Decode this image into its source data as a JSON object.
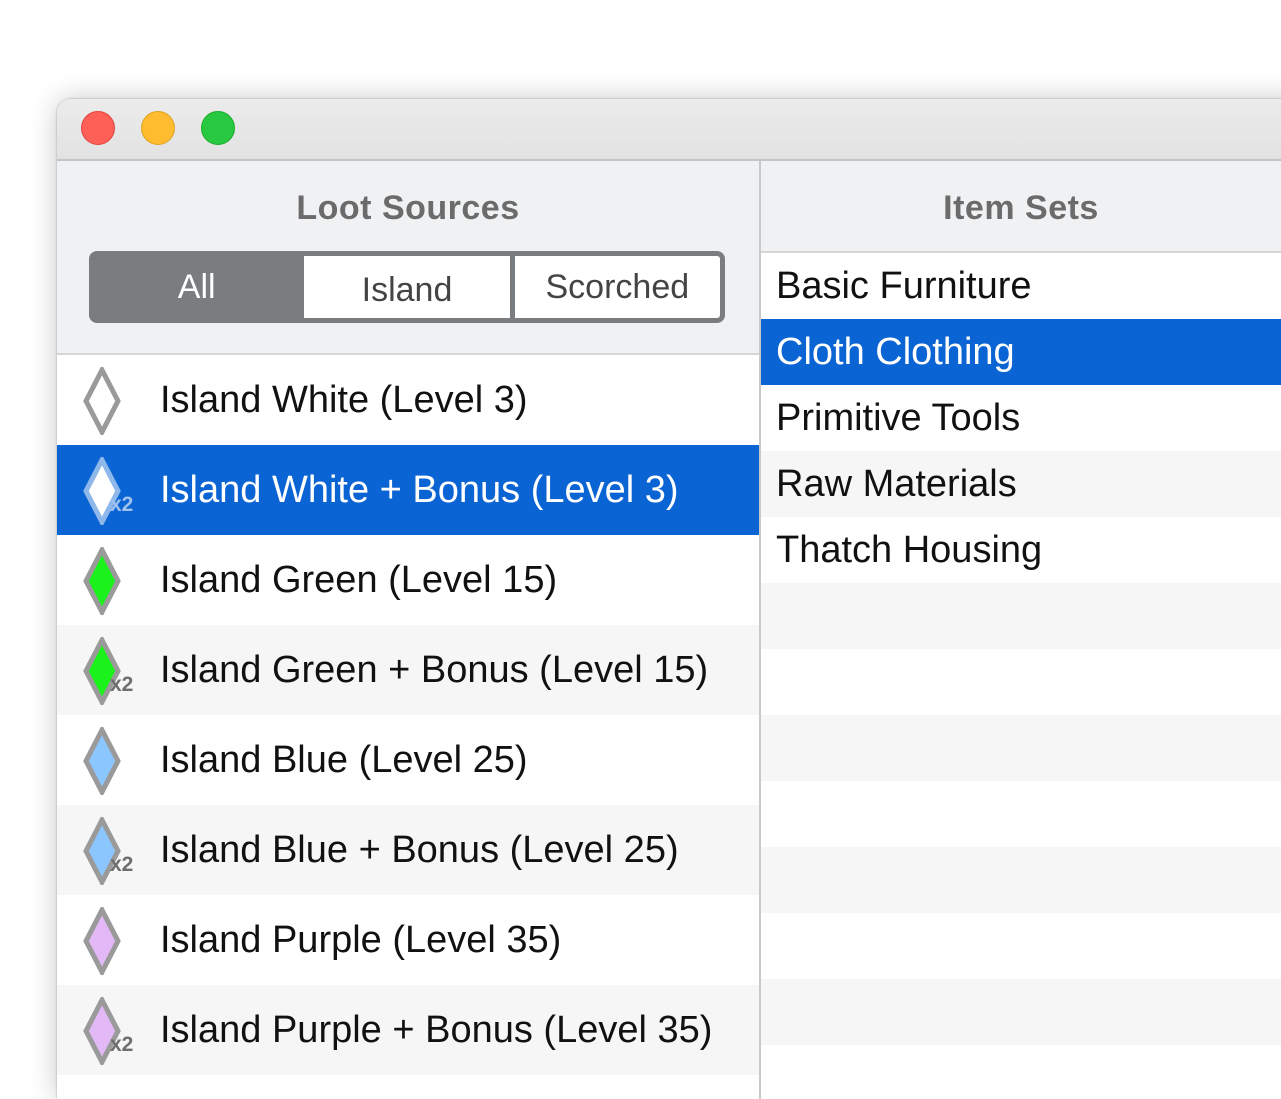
{
  "window": {
    "controls": [
      "close",
      "minimize",
      "zoom"
    ]
  },
  "loot_panel": {
    "title": "Loot Sources",
    "filter_segments": [
      {
        "label": "All",
        "selected": true
      },
      {
        "label": "Island",
        "selected": false
      },
      {
        "label": "Scorched",
        "selected": false
      }
    ],
    "items": [
      {
        "label": "Island White (Level 3)",
        "color": "#ffffff",
        "bonus": "",
        "selected": false
      },
      {
        "label": "Island White + Bonus (Level 3)",
        "color": "#ffffff",
        "bonus": "x2",
        "selected": true
      },
      {
        "label": "Island Green (Level 15)",
        "color": "#1bf21b",
        "bonus": "",
        "selected": false
      },
      {
        "label": "Island Green + Bonus (Level 15)",
        "color": "#1bf21b",
        "bonus": "x2",
        "selected": false
      },
      {
        "label": "Island Blue (Level 25)",
        "color": "#8cc6ff",
        "bonus": "",
        "selected": false
      },
      {
        "label": "Island Blue + Bonus (Level 25)",
        "color": "#8cc6ff",
        "bonus": "x2",
        "selected": false
      },
      {
        "label": "Island Purple (Level 35)",
        "color": "#e2b8f6",
        "bonus": "",
        "selected": false
      },
      {
        "label": "Island Purple + Bonus (Level 35)",
        "color": "#e2b8f6",
        "bonus": "x2",
        "selected": false
      }
    ]
  },
  "sets_panel": {
    "title": "Item Sets",
    "items": [
      {
        "label": "Basic Furniture",
        "selected": false
      },
      {
        "label": "Cloth Clothing",
        "selected": true
      },
      {
        "label": "Primitive Tools",
        "selected": false
      },
      {
        "label": "Raw Materials",
        "selected": false
      },
      {
        "label": "Thatch Housing",
        "selected": false
      },
      {
        "label": "",
        "selected": false
      },
      {
        "label": "",
        "selected": false
      },
      {
        "label": "",
        "selected": false
      },
      {
        "label": "",
        "selected": false
      },
      {
        "label": "",
        "selected": false
      },
      {
        "label": "",
        "selected": false
      },
      {
        "label": "",
        "selected": false
      }
    ]
  },
  "colors": {
    "selection": "#0a64d3",
    "segment_active": "#7a7d80",
    "icon_stroke": "#9a9a9a"
  },
  "icons": {
    "loot_quality": "diamond-icon",
    "bonus_badge": "x2"
  }
}
